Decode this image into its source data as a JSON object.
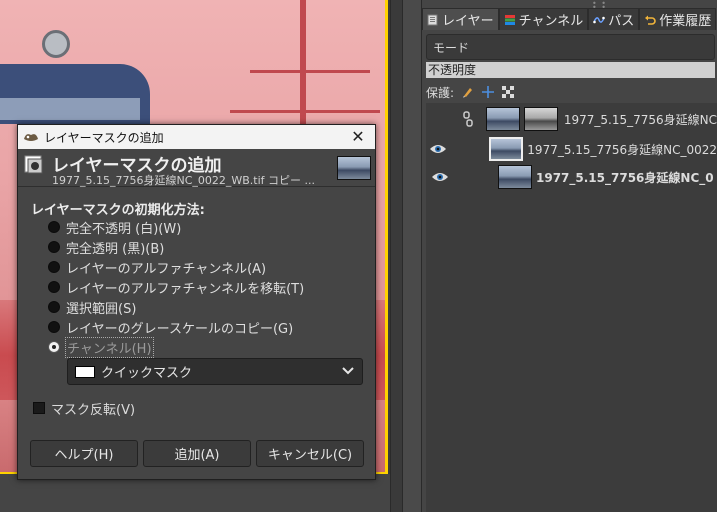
{
  "dock": {
    "tabs": [
      {
        "label": "レイヤー",
        "icon": "layers-icon"
      },
      {
        "label": "チャンネル",
        "icon": "channels-icon"
      },
      {
        "label": "パス",
        "icon": "paths-icon"
      },
      {
        "label": "作業履歴",
        "icon": "undo-history-icon"
      }
    ],
    "mode_label": "モード",
    "opacity_label": "不透明度",
    "lock_label": "保護:",
    "layers": [
      {
        "name": "1977_5.15_7756身延線NC",
        "bold": false,
        "visible": false,
        "has_mask": true
      },
      {
        "name": "1977_5.15_7756身延線NC_0022",
        "bold": false,
        "visible": true,
        "has_mask": false
      },
      {
        "name": "1977_5.15_7756身延線NC_0",
        "bold": true,
        "visible": true,
        "has_mask": false
      }
    ]
  },
  "dialog": {
    "window_title": "レイヤーマスクの追加",
    "header_title": "レイヤーマスクの追加",
    "header_subtitle": "1977_5.15_7756身延線NC_0022_WB.tif コピー ...",
    "section_label": "レイヤーマスクの初期化方法:",
    "options": [
      {
        "label": "完全不透明 (白)(W)",
        "selected": false
      },
      {
        "label": "完全透明 (黒)(B)",
        "selected": false
      },
      {
        "label": "レイヤーのアルファチャンネル(A)",
        "selected": false
      },
      {
        "label": "レイヤーのアルファチャンネルを移転(T)",
        "selected": false
      },
      {
        "label": "選択範囲(S)",
        "selected": false
      },
      {
        "label": "レイヤーのグレースケールのコピー(G)",
        "selected": false
      },
      {
        "label": "チャンネル(H)",
        "selected": true
      }
    ],
    "channel_value": "クイックマスク",
    "invert_label": "マスク反転(V)",
    "buttons": {
      "help": "ヘルプ(H)",
      "add": "追加(A)",
      "cancel": "キャンセル(C)"
    }
  },
  "colors": {
    "quickmask_tint": "#e6989a",
    "canvas_border": "#ffd200",
    "dialog_bg": "#454545"
  }
}
